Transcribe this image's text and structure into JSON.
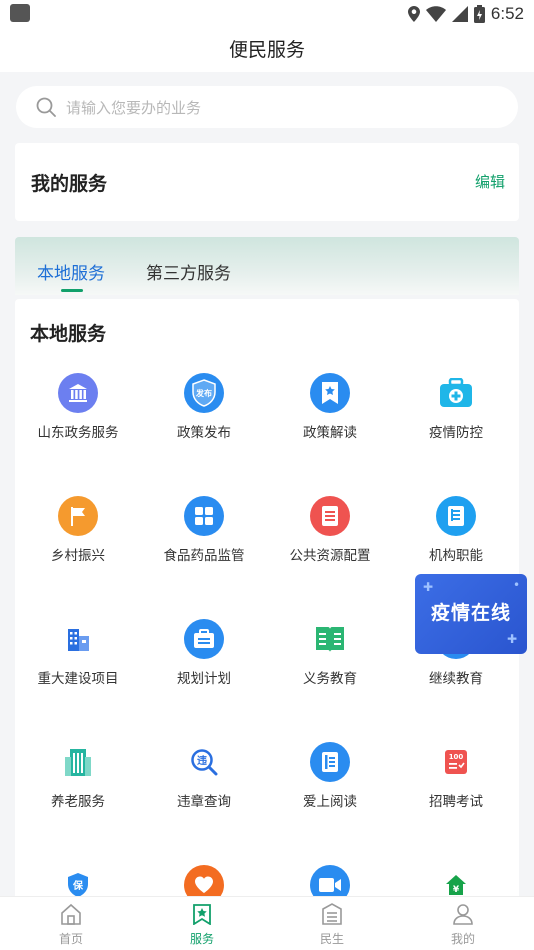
{
  "status": {
    "time": "6:52"
  },
  "header": {
    "title": "便民服务"
  },
  "search": {
    "placeholder": "请输入您要办的业务"
  },
  "my_services": {
    "title": "我的服务",
    "edit_label": "编辑"
  },
  "tabs": [
    {
      "label": "本地服务",
      "active": true
    },
    {
      "label": "第三方服务",
      "active": false
    }
  ],
  "local": {
    "title": "本地服务",
    "items": [
      {
        "label": "山东政务服务",
        "icon": "government-building-icon",
        "color": "#6c7ff0"
      },
      {
        "label": "政策发布",
        "icon": "policy-release-icon",
        "color": "#2a8cf0",
        "glyph": "发布"
      },
      {
        "label": "政策解读",
        "icon": "bookmark-star-icon",
        "color": "#2a8cf0"
      },
      {
        "label": "疫情防控",
        "icon": "medical-kit-icon",
        "color": "#1fb6e8"
      },
      {
        "label": "乡村振兴",
        "icon": "flag-icon",
        "color": "#f59a2e"
      },
      {
        "label": "食品药品监管",
        "icon": "grid-icon",
        "color": "#2a8cf0"
      },
      {
        "label": "公共资源配置",
        "icon": "document-list-icon",
        "color": "#ef5350"
      },
      {
        "label": "机构职能",
        "icon": "book-icon",
        "color": "#1fa0f0"
      },
      {
        "label": "重大建设项目",
        "icon": "buildings-icon",
        "color": "#2a6fe0"
      },
      {
        "label": "规划计划",
        "icon": "briefcase-icon",
        "color": "#2a8cf0"
      },
      {
        "label": "义务教育",
        "icon": "open-book-icon",
        "color": "#2bb673"
      },
      {
        "label": "继续教育",
        "icon": "graduation-icon",
        "color": "#2a8cf0"
      },
      {
        "label": "养老服务",
        "icon": "apartment-icon",
        "color": "#26b5a0"
      },
      {
        "label": "违章查询",
        "icon": "violation-search-icon",
        "color": "#2a6fe0",
        "glyph": "违"
      },
      {
        "label": "爱上阅读",
        "icon": "reading-icon",
        "color": "#2a8cf0"
      },
      {
        "label": "招聘考试",
        "icon": "exam-paper-icon",
        "color": "#ef5350",
        "glyph": "100"
      },
      {
        "label": "",
        "icon": "insurance-shield-icon",
        "color": "#2a8cf0",
        "glyph": "保"
      },
      {
        "label": "",
        "icon": "heart-hands-icon",
        "color": "#f36c21"
      },
      {
        "label": "",
        "icon": "video-camera-icon",
        "color": "#2a8cf0"
      },
      {
        "label": "",
        "icon": "house-yuan-icon",
        "color": "#17a34a",
        "glyph": "¥"
      }
    ]
  },
  "floating_banner": {
    "text": "疫情在线"
  },
  "bottom_nav": [
    {
      "label": "首页",
      "icon": "home-icon",
      "active": false
    },
    {
      "label": "服务",
      "icon": "service-star-icon",
      "active": true
    },
    {
      "label": "民生",
      "icon": "livelihood-icon",
      "active": false
    },
    {
      "label": "我的",
      "icon": "person-icon",
      "active": false
    }
  ]
}
